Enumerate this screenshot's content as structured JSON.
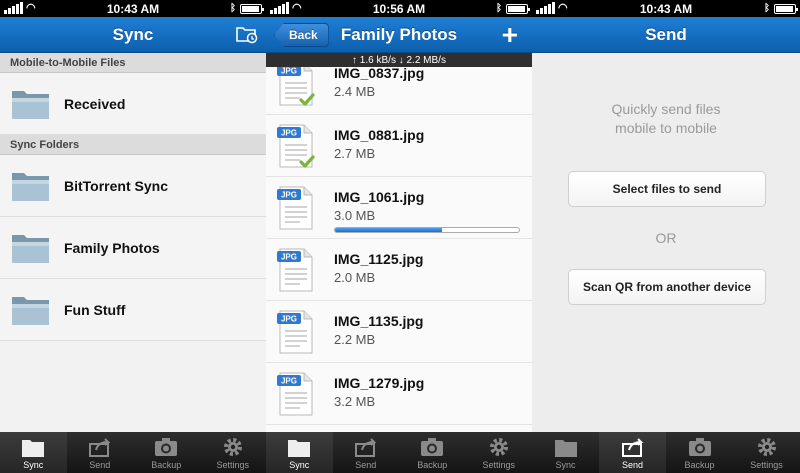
{
  "panels": [
    {
      "status_time": "10:43 AM",
      "title": "Sync",
      "sections": [
        {
          "header": "Mobile-to-Mobile Files",
          "folders": [
            "Received"
          ]
        },
        {
          "header": "Sync Folders",
          "folders": [
            "BitTorrent Sync",
            "Family Photos",
            "Fun Stuff"
          ]
        }
      ],
      "tabs": [
        "Sync",
        "Send",
        "Backup",
        "Settings"
      ],
      "active_tab": "Sync"
    },
    {
      "status_time": "10:56 AM",
      "title": "Family Photos",
      "back_label": "Back",
      "add_label": "+",
      "speed": "↑ 1.6 kB/s ↓ 2.2 MB/s",
      "file_badge": "JPG",
      "files": [
        {
          "name": "IMG_0837.jpg",
          "size": "2.4 MB",
          "synced": true
        },
        {
          "name": "IMG_0881.jpg",
          "size": "2.7 MB",
          "synced": true
        },
        {
          "name": "IMG_1061.jpg",
          "size": "3.0 MB",
          "synced": false,
          "progress": 0.58
        },
        {
          "name": "IMG_1125.jpg",
          "size": "2.0 MB",
          "synced": false
        },
        {
          "name": "IMG_1135.jpg",
          "size": "2.2 MB",
          "synced": false
        },
        {
          "name": "IMG_1279.jpg",
          "size": "3.2 MB",
          "synced": false
        }
      ],
      "tabs": [
        "Sync",
        "Send",
        "Backup",
        "Settings"
      ],
      "active_tab": "Sync"
    },
    {
      "status_time": "10:43 AM",
      "title": "Send",
      "message_line1": "Quickly send files",
      "message_line2": "mobile to mobile",
      "select_button": "Select files to send",
      "or_text": "OR",
      "scan_button": "Scan QR from another device",
      "tabs": [
        "Sync",
        "Send",
        "Backup",
        "Settings"
      ],
      "active_tab": "Send"
    }
  ],
  "colors": {
    "navbar": "#0d5fae",
    "progress": "#1d6ed0",
    "synced_check": "#7ab43a"
  },
  "icons": [
    "signal-icon",
    "wifi-icon",
    "bluetooth-icon",
    "battery-icon",
    "folder-icon",
    "add-folder-icon",
    "file-jpg-icon",
    "checkmark-icon",
    "sync-tab-icon",
    "send-tab-icon",
    "backup-camera-icon",
    "settings-gear-icon"
  ]
}
